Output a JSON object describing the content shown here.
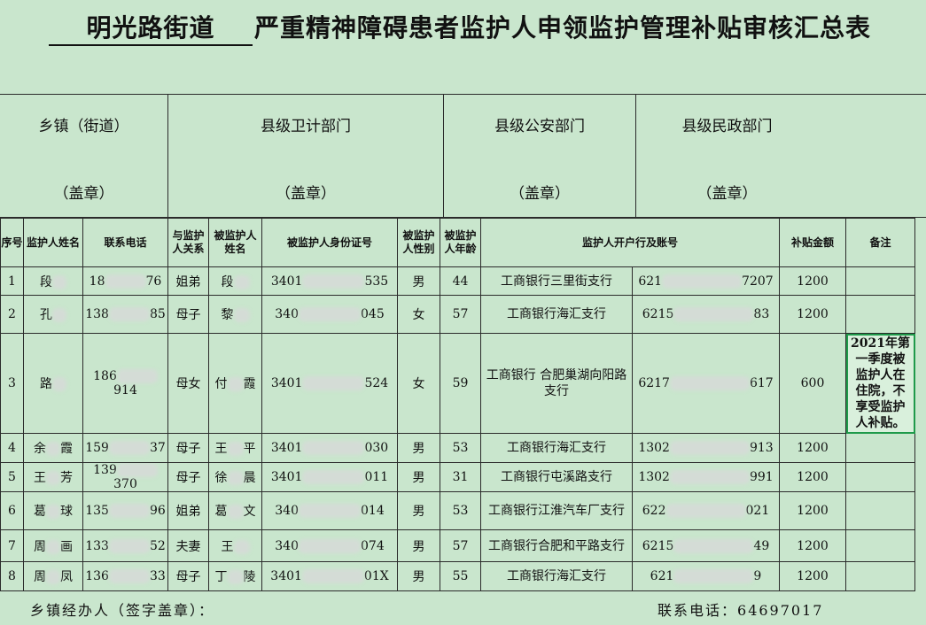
{
  "title": {
    "street": "明光路街道",
    "main": "严重精神障碍患者监护人申领监护管理补贴审核汇总表"
  },
  "departments": [
    {
      "name": "乡镇（街道）",
      "seal": "（盖章）"
    },
    {
      "name": "县级卫计部门",
      "seal": "（盖章）"
    },
    {
      "name": "县级公安部门",
      "seal": "（盖章）"
    },
    {
      "name": "县级民政部门",
      "seal": "（盖章）"
    }
  ],
  "headers": {
    "seq": "序号",
    "guardian": "监护人姓名",
    "phone": "联系电话",
    "relation": "与监护人关系",
    "ward": "被监护人姓名",
    "id": "被监护人身份证号",
    "gender": "被监护人性别",
    "age": "被监护人年龄",
    "bank": "监护人开户行及账号",
    "amount": "补贴金额",
    "note": "备注"
  },
  "rows": [
    {
      "seq": "1",
      "guardian_a": "段",
      "guardian_b": "",
      "phone_a": "18",
      "phone_b": "76",
      "relation": "姐弟",
      "ward_a": "段",
      "ward_b": "",
      "id_a": "3401",
      "id_b": "535",
      "gender": "男",
      "age": "44",
      "bank": "工商银行三里街支行",
      "acct_a": "621",
      "acct_b": "7207",
      "amount": "1200",
      "note": ""
    },
    {
      "seq": "2",
      "guardian_a": "孔",
      "guardian_b": "",
      "phone_a": "138",
      "phone_b": "85",
      "relation": "母子",
      "ward_a": "黎",
      "ward_b": "",
      "id_a": "340",
      "id_b": "045",
      "gender": "女",
      "age": "57",
      "bank": "工商银行海汇支行",
      "acct_a": "6215",
      "acct_b": "83",
      "amount": "1200",
      "note": ""
    },
    {
      "seq": "3",
      "guardian_a": "路",
      "guardian_b": "",
      "phone_a": "186",
      "phone_b": "914",
      "relation": "母女",
      "ward_a": "付",
      "ward_b": "霞",
      "id_a": "3401",
      "id_b": "524",
      "gender": "女",
      "age": "59",
      "bank": "工商银行 合肥巢湖向阳路支行",
      "acct_a": "6217",
      "acct_b": "617",
      "amount": "600",
      "note": "2021年第一季度被监护人在住院，不享受监护人补贴。"
    },
    {
      "seq": "4",
      "guardian_a": "余",
      "guardian_b": "霞",
      "phone_a": "159",
      "phone_b": "37",
      "relation": "母子",
      "ward_a": "王",
      "ward_b": "平",
      "id_a": "3401",
      "id_b": "030",
      "gender": "男",
      "age": "53",
      "bank": "工商银行海汇支行",
      "acct_a": "1302",
      "acct_b": "913",
      "amount": "1200",
      "note": ""
    },
    {
      "seq": "5",
      "guardian_a": "王",
      "guardian_b": "芳",
      "phone_a": "139",
      "phone_b": "370",
      "relation": "母子",
      "ward_a": "徐",
      "ward_b": "晨",
      "id_a": "3401",
      "id_b": "011",
      "gender": "男",
      "age": "31",
      "bank": "工商银行屯溪路支行",
      "acct_a": "1302",
      "acct_b": "991",
      "amount": "1200",
      "note": ""
    },
    {
      "seq": "6",
      "guardian_a": "葛",
      "guardian_b": "球",
      "phone_a": "135",
      "phone_b": "96",
      "relation": "姐弟",
      "ward_a": "葛",
      "ward_b": "文",
      "id_a": "340",
      "id_b": "014",
      "gender": "男",
      "age": "53",
      "bank": "工商银行江淮汽车厂支行",
      "acct_a": "622",
      "acct_b": "021",
      "amount": "1200",
      "note": ""
    },
    {
      "seq": "7",
      "guardian_a": "周",
      "guardian_b": "画",
      "phone_a": "133",
      "phone_b": "52",
      "relation": "夫妻",
      "ward_a": "王",
      "ward_b": "",
      "id_a": "340",
      "id_b": "074",
      "gender": "男",
      "age": "57",
      "bank": "工商银行合肥和平路支行",
      "acct_a": "6215",
      "acct_b": "49",
      "amount": "1200",
      "note": ""
    },
    {
      "seq": "8",
      "guardian_a": "周",
      "guardian_b": "凤",
      "phone_a": "136",
      "phone_b": "33",
      "relation": "母子",
      "ward_a": "丁",
      "ward_b": "陵",
      "id_a": "3401",
      "id_b": "01X",
      "gender": "男",
      "age": "55",
      "bank": "工商银行海汇支行",
      "acct_a": "621",
      "acct_b": "9",
      "amount": "1200",
      "note": ""
    }
  ],
  "footer": {
    "handler": "乡镇经办人（签字盖章）：",
    "contact_label": "联系电话：",
    "contact_number": "64697017"
  }
}
